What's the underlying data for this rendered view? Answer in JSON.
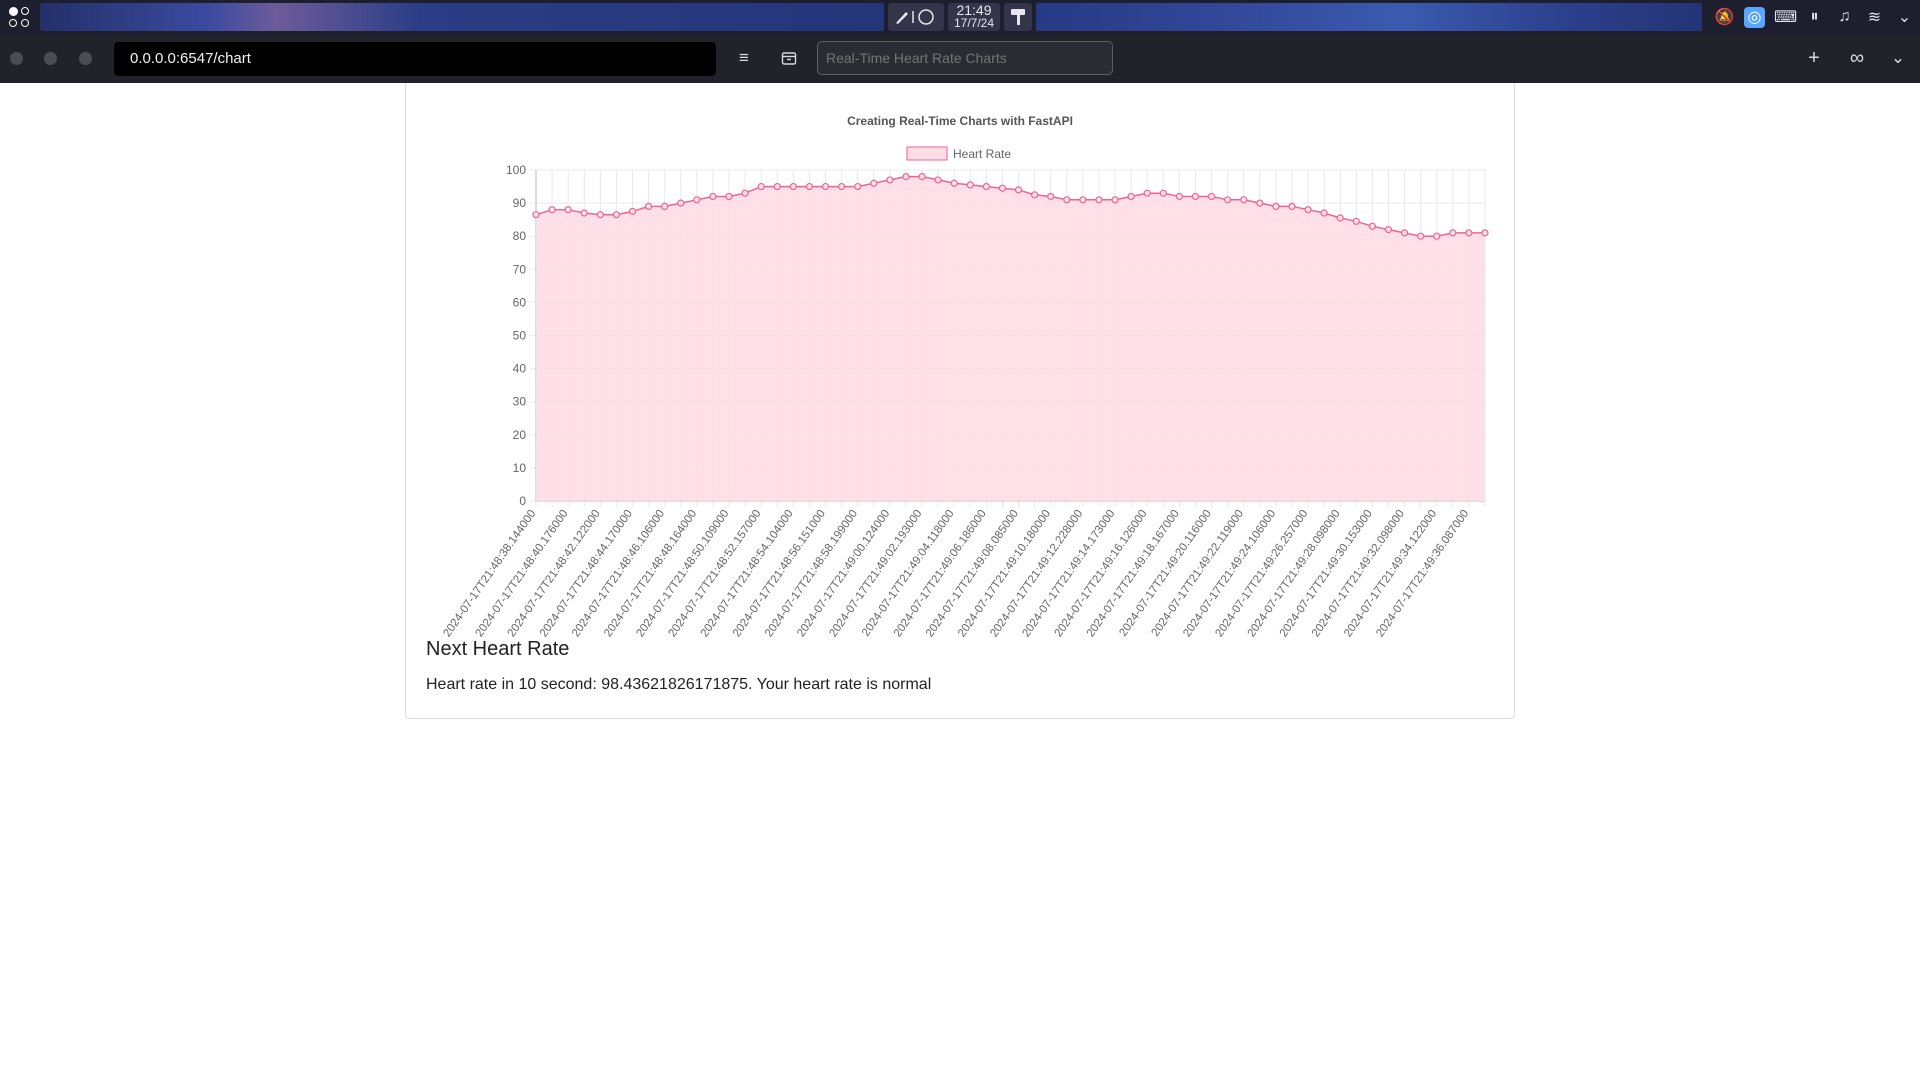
{
  "system_bar": {
    "clock_time": "21:49",
    "clock_date": "17/7/24"
  },
  "browser": {
    "url": "0.0.0.0:6547/chart",
    "search_placeholder": "Real-Time Heart Rate Charts"
  },
  "page": {
    "next_title": "Next Heart Rate",
    "next_text": "Heart rate in 10 second: 98.43621826171875. Your heart rate is normal"
  },
  "colors": {
    "series_line": "#f06292",
    "series_fill": "#ffdde5",
    "grid": "#e9e9e9"
  },
  "chart_data": {
    "type": "area",
    "title": "Creating Real-Time Charts with FastAPI",
    "legend_position": "top-center",
    "grid": true,
    "ylim": [
      0,
      100
    ],
    "yticks": [
      0,
      10,
      20,
      30,
      40,
      50,
      60,
      70,
      80,
      90,
      100
    ],
    "x": [
      "2024-07-17T21:48:38.144000",
      "2024-07-17T21:48:40.176000",
      "2024-07-17T21:48:42.122000",
      "2024-07-17T21:48:44.170000",
      "2024-07-17T21:48:46.106000",
      "2024-07-17T21:48:48.164000",
      "2024-07-17T21:48:50.109000",
      "2024-07-17T21:48:52.157000",
      "2024-07-17T21:48:54.104000",
      "2024-07-17T21:48:56.151000",
      "2024-07-17T21:48:58.199000",
      "2024-07-17T21:49:00.124000",
      "2024-07-17T21:49:02.193000",
      "2024-07-17T21:49:04.118000",
      "2024-07-17T21:49:06.186000",
      "2024-07-17T21:49:08.085000",
      "2024-07-17T21:49:10.180000",
      "2024-07-17T21:49:12.228000",
      "2024-07-17T21:49:14.173000",
      "2024-07-17T21:49:16.126000",
      "2024-07-17T21:49:18.167000",
      "2024-07-17T21:49:20.116000",
      "2024-07-17T21:49:22.119000",
      "2024-07-17T21:49:24.106000",
      "2024-07-17T21:49:26.257000",
      "2024-07-17T21:49:28.098000",
      "2024-07-17T21:49:30.153000",
      "2024-07-17T21:49:32.098000",
      "2024-07-17T21:49:34.122000",
      "2024-07-17T21:49:36.087000"
    ],
    "series": [
      {
        "name": "Heart Rate",
        "values": [
          86.5,
          88,
          88,
          87,
          86.5,
          86.5,
          87.5,
          89,
          89,
          90,
          91,
          92,
          92,
          93,
          95,
          95,
          95,
          95,
          95,
          95,
          95,
          96,
          97,
          98,
          98,
          97,
          96,
          95.5,
          95,
          94.5,
          94,
          92.5,
          92,
          91,
          91,
          91,
          91,
          92,
          93,
          93,
          92,
          92,
          92,
          91,
          91,
          90,
          89,
          89,
          88,
          87,
          85.5,
          84.5,
          83,
          82,
          81,
          80,
          80,
          81,
          81,
          81
        ]
      }
    ]
  }
}
